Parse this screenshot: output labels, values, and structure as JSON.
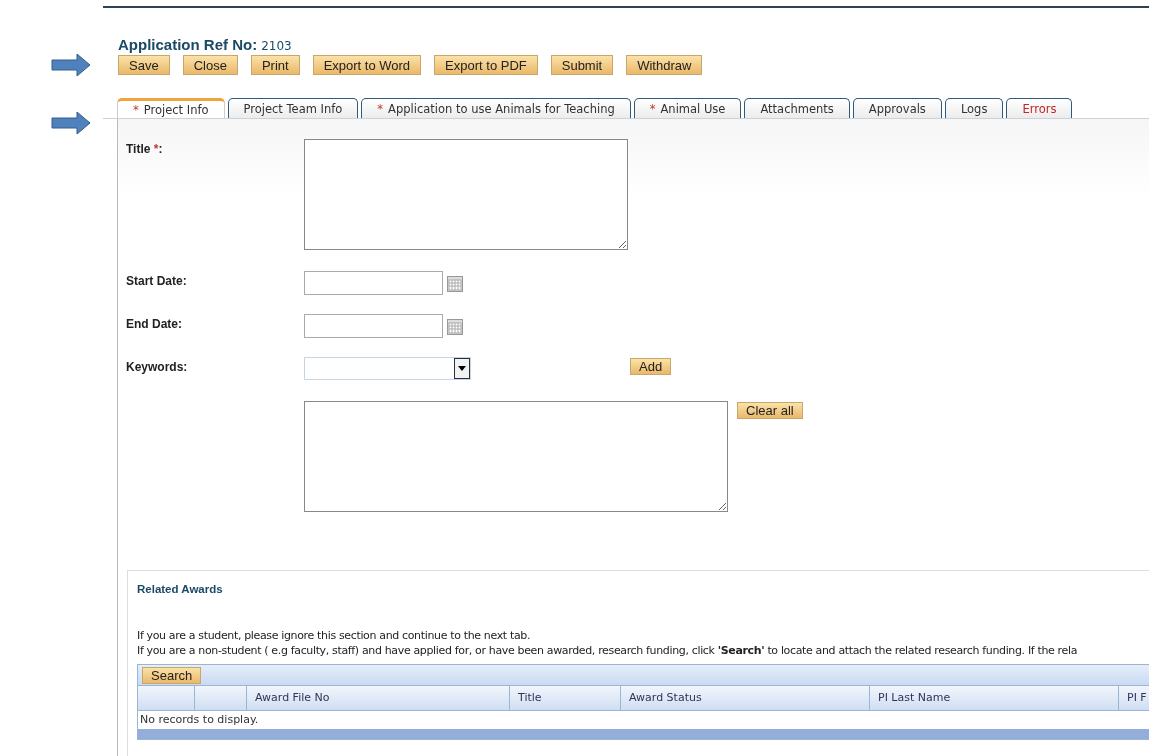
{
  "header": {
    "label": "Application Ref No:",
    "value": "2103"
  },
  "actions": [
    "Save",
    "Close",
    "Print",
    "Export to Word",
    "Export to PDF",
    "Submit",
    "Withdraw"
  ],
  "tabs": [
    {
      "marker": "*",
      "label": "Project Info",
      "selected": true,
      "kind": "normal"
    },
    {
      "label": "Project Team Info",
      "selected": false,
      "kind": "normal"
    },
    {
      "marker": "*",
      "label": "Application to use Animals for Teaching",
      "selected": false,
      "kind": "normal"
    },
    {
      "marker": "*",
      "label": "Animal Use",
      "selected": false,
      "kind": "normal"
    },
    {
      "label": "Attachments",
      "selected": false,
      "kind": "normal"
    },
    {
      "label": "Approvals",
      "selected": false,
      "kind": "normal"
    },
    {
      "label": "Logs",
      "selected": false,
      "kind": "normal"
    },
    {
      "label": "Errors",
      "selected": false,
      "kind": "error"
    }
  ],
  "form": {
    "title": {
      "label": "Title",
      "marker": "*",
      "suffix": ":"
    },
    "start_date": {
      "label": "Start Date:"
    },
    "end_date": {
      "label": "End Date:"
    },
    "keywords": {
      "label": "Keywords:",
      "add_button": "Add",
      "clear_button": "Clear all"
    }
  },
  "related_awards": {
    "heading": "Related Awards",
    "notes": [
      "If you are a student, please ignore this section and continue to the next tab.",
      "If you are a non-student ( e.g faculty, staff) and have applied for, or have been awarded, research funding, click **'Search'** to locate and attach the related research funding. If the rela"
    ],
    "search_button": "Search",
    "columns": [
      "",
      "",
      "Award File No",
      "Title",
      "Award Status",
      "PI Last Name",
      "PI F"
    ],
    "empty_message": "No records to display."
  }
}
